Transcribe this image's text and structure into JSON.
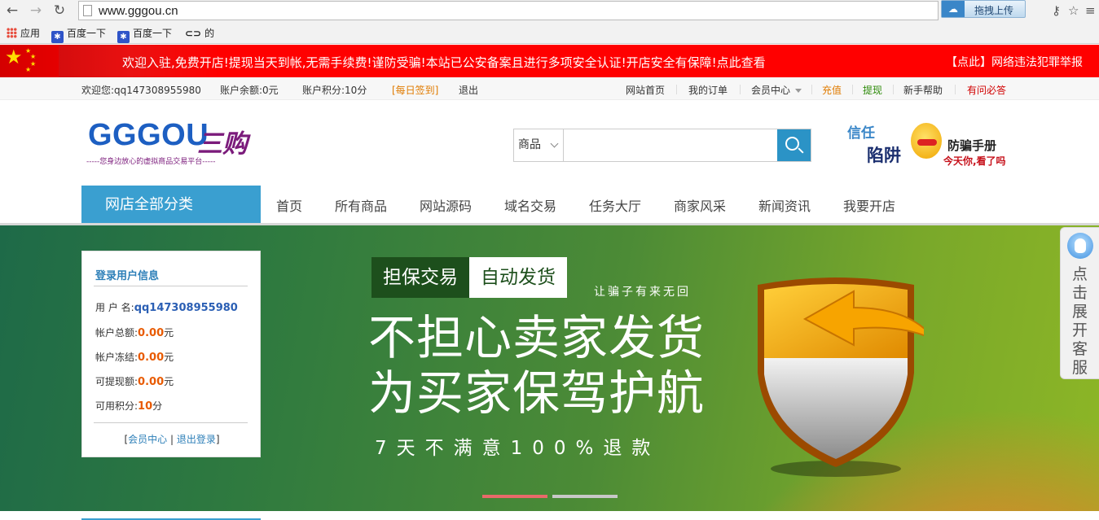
{
  "browser": {
    "url": "www.gggou.cn",
    "upload_label": "拖拽上传",
    "bookmarks": [
      "应用",
      "百度一下",
      "百度一下",
      "的"
    ]
  },
  "notice": {
    "text": "欢迎入驻,免费开店!提现当天到帐,无需手续费!谨防受骗!本站已公安备案且进行多项安全认证!开店安全有保障!点此查看",
    "report_link": "【点此】网络违法犯罪举报"
  },
  "topbar": {
    "welcome": "欢迎您:qq147308955980",
    "balance": "账户余额:0元",
    "points": "账户积分:10分",
    "signin": "[每日签到]",
    "logout": "退出",
    "links": [
      "网站首页",
      "我的订单",
      "会员中心",
      "充值",
      "提现",
      "新手帮助",
      "有问必答"
    ]
  },
  "header": {
    "logo_en": "GGGOU",
    "logo_cn": "三购",
    "logo_slogan": "-----您身边放心的虚拟商品交易平台-----",
    "search_category": "商品",
    "search_placeholder": "",
    "ad": {
      "line1": "信任",
      "line2": "陷阱",
      "line3": "防骗手册",
      "line4": "今天你,看了吗"
    }
  },
  "nav": {
    "all_categories": "网店全部分类",
    "items": [
      "首页",
      "所有商品",
      "网站源码",
      "域名交易",
      "任务大厅",
      "商家风采",
      "新闻资讯",
      "我要开店"
    ]
  },
  "user_panel": {
    "title": "登录用户信息",
    "username_label": "用 户 名:",
    "username": "qq147308955980",
    "total_label": "帐户总额:",
    "total": "0.00",
    "frozen_label": "帐户冻结:",
    "frozen": "0.00",
    "withdrawable_label": "可提现额:",
    "withdrawable": "0.00",
    "points_label": "可用积分:",
    "points": "10",
    "yuan": "元",
    "fen": "分",
    "member_center": "会员中心",
    "logout": "退出登录"
  },
  "banner": {
    "tag1": "担保交易",
    "tag2": "自动发货",
    "tagline": "让骗子有来无回",
    "headline1": "不担心卖家发货",
    "headline2": "为买家保驾护航",
    "promise": "7天不满意100%退款",
    "slide_count": 2,
    "active_slide": 1
  },
  "service": {
    "label": "点击展开客服"
  },
  "colors": {
    "accent": "#3a9fd0",
    "notice_bg": "#ff0000",
    "amount": "#e85a00"
  }
}
